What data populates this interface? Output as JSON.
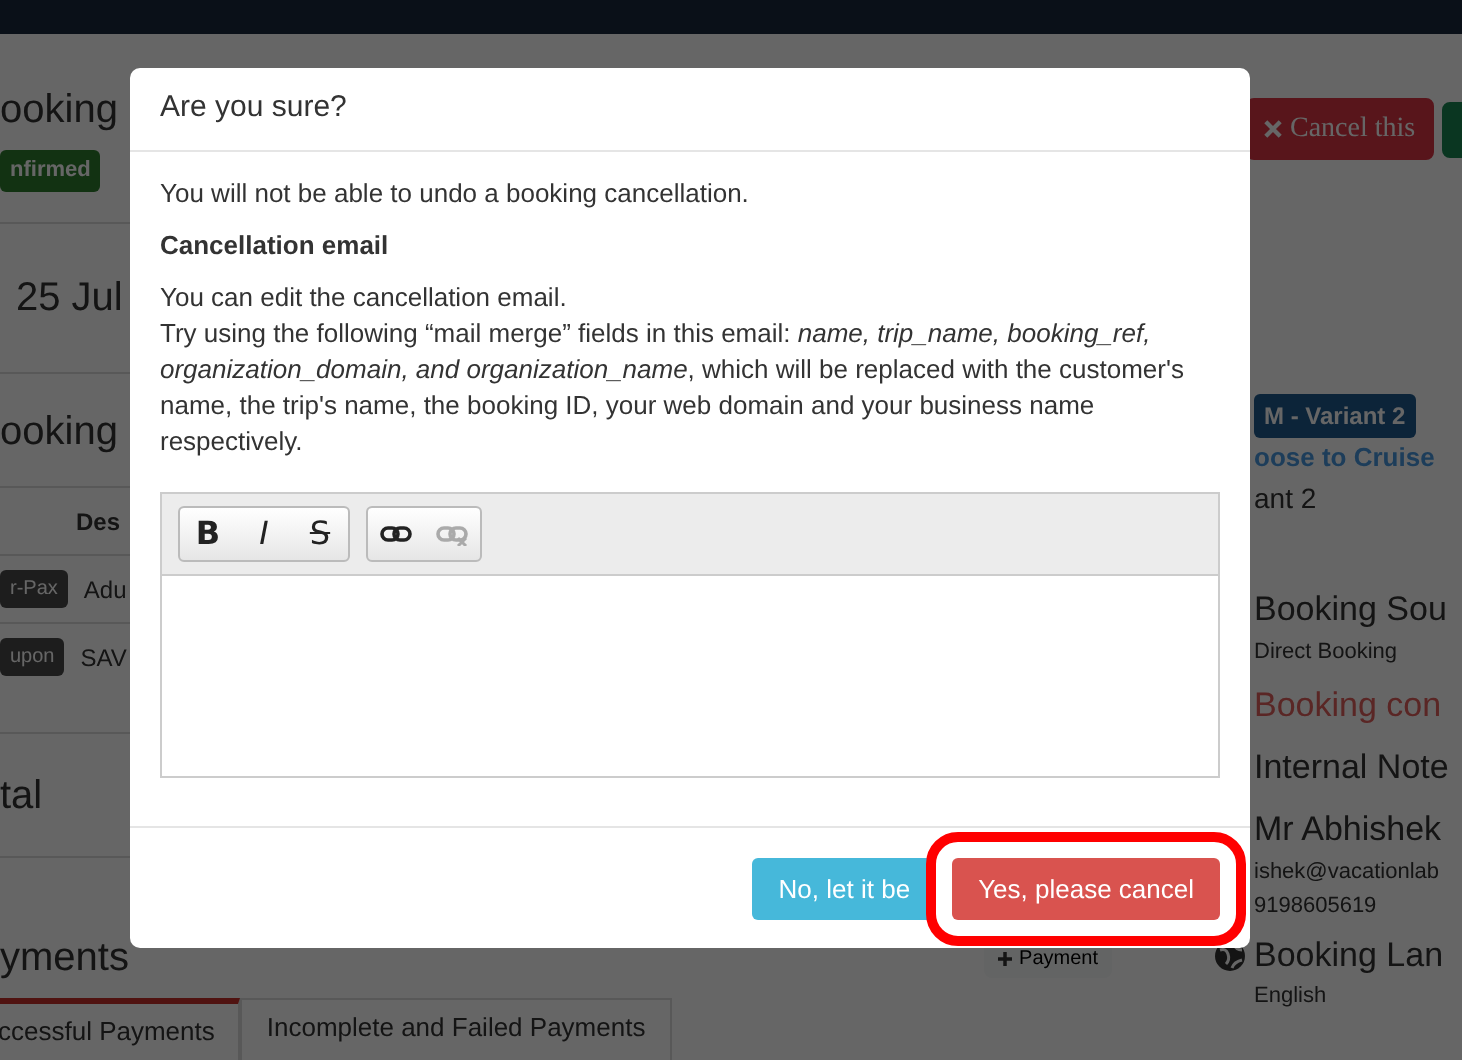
{
  "page": {
    "title": "ooking",
    "status_badge": "nfirmed",
    "date": "25 Jul",
    "cancel_button": "Cancel this",
    "items_title": "ooking",
    "items_column": "Des",
    "items": [
      {
        "tag": "r-Pax",
        "description": "Adu"
      },
      {
        "tag": "upon",
        "description": "SAV"
      }
    ],
    "total_label": "tal",
    "payments_title": "yments",
    "add_payment_button": "Payment",
    "payment_tabs": [
      {
        "label": "ccessful Payments",
        "selected": true
      },
      {
        "label": "Incomplete and Failed Payments",
        "selected": false
      }
    ],
    "trip": {
      "variant_badge": "M - Variant 2",
      "name": "oose to Cruise",
      "variant": "ant 2"
    },
    "sidebar": [
      {
        "kind": "heading",
        "text": "Booking Sou"
      },
      {
        "kind": "text",
        "text": "Direct Booking"
      },
      {
        "kind": "alert",
        "text": "Booking con"
      },
      {
        "kind": "heading",
        "text": "Internal Note"
      },
      {
        "kind": "heading",
        "text": "Mr Abhishek"
      },
      {
        "kind": "text",
        "text": "ishek@vacationlab"
      },
      {
        "kind": "text",
        "text": "9198605619"
      },
      {
        "kind": "language",
        "text": "Booking Lan"
      },
      {
        "kind": "text",
        "text": "English"
      }
    ]
  },
  "modal": {
    "title": "Are you sure?",
    "warning": "You will not be able to undo a booking cancellation.",
    "email_heading": "Cancellation email",
    "intro": "You can edit the cancellation email.",
    "help": "Try using the following “mail merge” fields in this email: *name, trip_name, booking_ref, organization_domain, and organization_name*, which will be replaced with the customer's name, the trip's name, the booking ID, your web domain and your business name respectively.",
    "toolbar": [
      [
        {
          "kind": "bold",
          "glyph": "B",
          "disabled": false
        },
        {
          "kind": "italic",
          "glyph": "I",
          "disabled": false
        },
        {
          "kind": "strike",
          "glyph": "S",
          "disabled": false
        }
      ],
      [
        {
          "kind": "link",
          "disabled": false
        },
        {
          "kind": "unlink",
          "disabled": true
        }
      ]
    ],
    "buttons": [
      {
        "kind": "info",
        "label": "No, let it be",
        "highlighted": false
      },
      {
        "kind": "danger",
        "label": "Yes, please cancel",
        "highlighted": true
      }
    ]
  }
}
